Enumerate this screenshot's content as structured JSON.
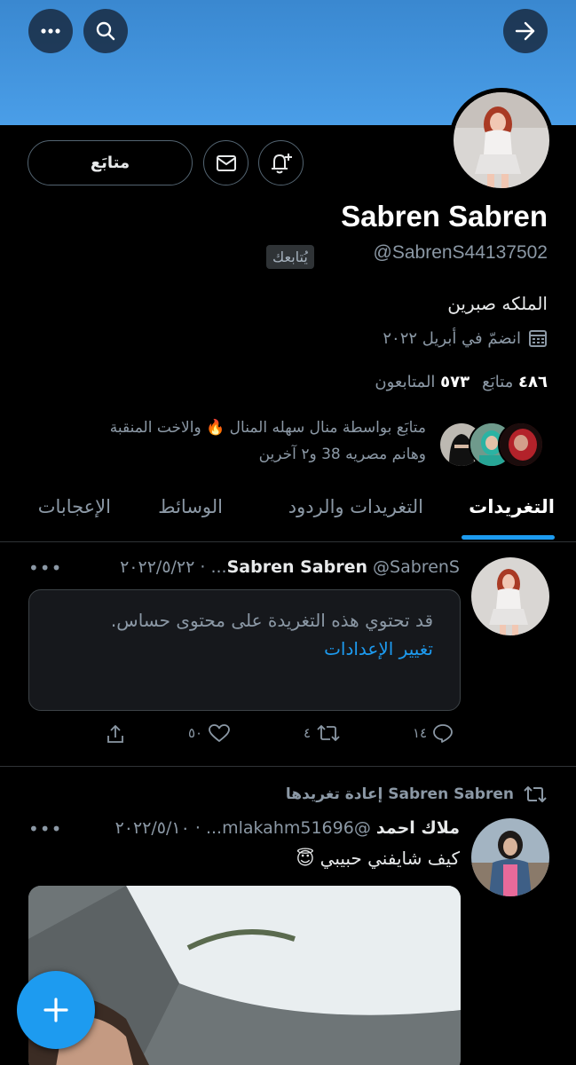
{
  "profile": {
    "name": "Sabren Sabren",
    "handle": "@SabrenS44137502",
    "follows_you": "يُتابعك",
    "bio": "الملكه صبرين",
    "joined": "انضمّ في أبريل ٢٠٢٢",
    "following_count": "٤٨٦",
    "following_label": "متابَع",
    "followers_count": "٥٧٣",
    "followers_label": "المتابعون",
    "followed_by_line1": "متابَع بواسطة منال سهله المنال 🔥 والاخت المنقبة",
    "followed_by_line2": "وهانم مصريه 38 و٢ آخرين"
  },
  "actions": {
    "follow_label": "متابَع"
  },
  "tabs": [
    {
      "label": "التغريدات",
      "active": true
    },
    {
      "label": "التغريدات والردود",
      "active": false
    },
    {
      "label": "الوسائط",
      "active": false
    },
    {
      "label": "الإعجابات",
      "active": false
    }
  ],
  "tweet1": {
    "name": "Sabren Sabren",
    "meta": "@SabrenS... · ٢٠٢٢/٥/٢٢",
    "sensitive_message": "قد تحتوي هذه التغريدة على محتوى حساس.",
    "change_settings": "تغيير الإعدادات",
    "replies": "١٤",
    "retweets": "٤",
    "likes": "٥٠"
  },
  "tweet2": {
    "retweeted_by": "Sabren Sabren إعادة تغريدها",
    "name": "ملاك احمد",
    "meta": "@mlakahm51696... · ٢٠٢٢/٥/١٠",
    "text": "كيف شايفني حبيبي 😇"
  },
  "colors": {
    "accent": "#1d9bf0",
    "banner": "#4a9ee8",
    "background": "#000000",
    "muted": "#8b98a5"
  }
}
